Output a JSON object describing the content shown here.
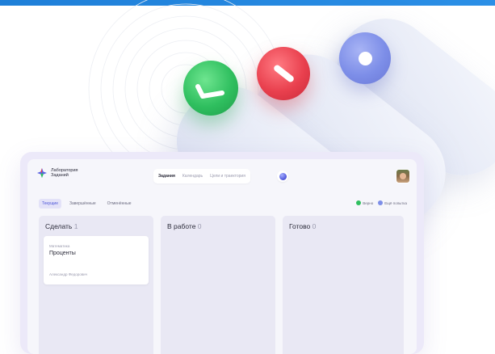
{
  "colors": {
    "accent": "#4f58d8",
    "top_bar": "#1e7fd8",
    "knob_green": "#2fbf5f",
    "knob_red": "#e9404e",
    "knob_blue": "#7d8ee8"
  },
  "app": {
    "logo": {
      "icon": "star-logo-icon",
      "line1": "Лаборатория",
      "line2": "Заданий"
    },
    "nav": {
      "items": [
        "Задания",
        "Календарь",
        "Цели и траектория"
      ],
      "active_index": 0
    },
    "globe_icon": "globe-icon",
    "avatar_icon": "user-avatar-icon",
    "tabs": {
      "items": [
        "Текущие",
        "Завершённые",
        "Отменённые"
      ],
      "active_index": 0
    },
    "legend": {
      "correct": "Верно",
      "retry": "Ещё попытка"
    },
    "columns": [
      {
        "title": "Сделать",
        "count": "1"
      },
      {
        "title": "В работе",
        "count": "0"
      },
      {
        "title": "Готово",
        "count": "0"
      }
    ],
    "card": {
      "subject": "Математика",
      "title": "Проценты",
      "author": "Александр Федорович"
    }
  }
}
